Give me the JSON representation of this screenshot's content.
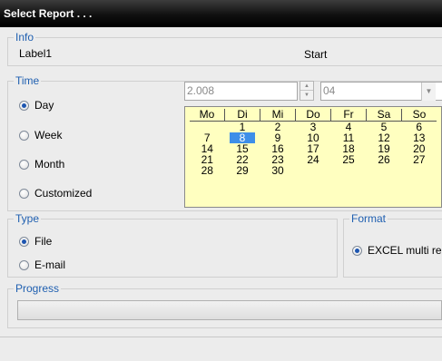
{
  "window": {
    "title": "Select Report . . ."
  },
  "info": {
    "legend": "Info",
    "label1": "Label1",
    "start": "Start"
  },
  "time": {
    "legend": "Time",
    "options": [
      {
        "label": "Day",
        "selected": true
      },
      {
        "label": "Week",
        "selected": false
      },
      {
        "label": "Month",
        "selected": false
      },
      {
        "label": "Customized",
        "selected": false
      }
    ],
    "year_value": "2.008",
    "month_value": "04"
  },
  "calendar": {
    "weekdays": [
      "Mo",
      "Di",
      "Mi",
      "Do",
      "Fr",
      "Sa",
      "So"
    ],
    "weeks": [
      [
        "",
        "1",
        "2",
        "3",
        "4",
        "5",
        "6"
      ],
      [
        "7",
        "8",
        "9",
        "10",
        "11",
        "12",
        "13"
      ],
      [
        "14",
        "15",
        "16",
        "17",
        "18",
        "19",
        "20"
      ],
      [
        "21",
        "22",
        "23",
        "24",
        "25",
        "26",
        "27"
      ],
      [
        "28",
        "29",
        "30",
        "",
        "",
        "",
        ""
      ]
    ],
    "selected_day": "8",
    "background": "#ffffc0",
    "selected_color": "#3d8ee8"
  },
  "type": {
    "legend": "Type",
    "options": [
      {
        "label": "File",
        "selected": true
      },
      {
        "label": "E-mail",
        "selected": false
      }
    ]
  },
  "format": {
    "legend": "Format",
    "options": [
      {
        "label": "EXCEL multi re",
        "selected": true
      }
    ]
  },
  "progress": {
    "legend": "Progress",
    "value": 0
  },
  "colors": {
    "legend_text": "#1f5fb0",
    "titlebar": "#000000"
  }
}
